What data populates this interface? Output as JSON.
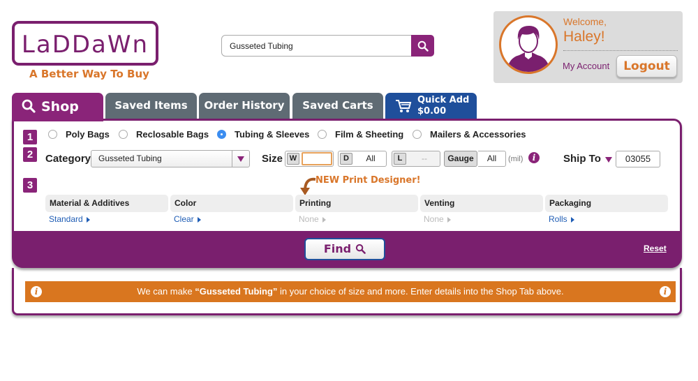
{
  "brand": {
    "logo_text": "LaDDaWn",
    "tagline": "A Better Way To Buy"
  },
  "search": {
    "value": "Gusseted Tubing",
    "icon": "search-icon"
  },
  "account": {
    "welcome": "Welcome,",
    "name": "Haley!",
    "my_account": "My Account",
    "logout": "Logout"
  },
  "tabs": {
    "shop": "Shop",
    "saved_items": "Saved Items",
    "order_history": "Order History",
    "saved_carts": "Saved Carts",
    "quick_add": {
      "label": "Quick Add",
      "amount": "$0.00"
    }
  },
  "steps": [
    "1",
    "2",
    "3"
  ],
  "product_types": [
    {
      "label": "Poly Bags",
      "selected": false
    },
    {
      "label": "Reclosable Bags",
      "selected": false
    },
    {
      "label": "Tubing & Sleeves",
      "selected": true
    },
    {
      "label": "Film & Sheeting",
      "selected": false
    },
    {
      "label": "Mailers & Accessories",
      "selected": false
    }
  ],
  "filters": {
    "category_label": "Category",
    "category_value": "Gusseted Tubing",
    "size_label": "Size",
    "width_key": "W",
    "width_value": "",
    "depth_key": "D",
    "depth_value": "All",
    "length_key": "L",
    "length_value": "--",
    "gauge_key": "Gauge",
    "gauge_value": "All",
    "gauge_unit": "(mil)",
    "ship_to_label": "Ship To",
    "ship_to_value": "03055"
  },
  "promo": "NEW Print Designer!",
  "options": [
    {
      "header": "Material & Additives",
      "value": "Standard",
      "enabled": true
    },
    {
      "header": "Color",
      "value": "Clear",
      "enabled": true
    },
    {
      "header": "Printing",
      "value": "None",
      "enabled": false
    },
    {
      "header": "Venting",
      "value": "None",
      "enabled": false
    },
    {
      "header": "Packaging",
      "value": "Rolls",
      "enabled": true
    }
  ],
  "actions": {
    "find": "Find",
    "reset": "Reset"
  },
  "banner": {
    "prefix": "We can make ",
    "product": "“Gusseted Tubing”",
    "suffix": " in your choice of size and more. Enter details into the Shop Tab above."
  },
  "colors": {
    "brand_purple": "#7a1f6e",
    "accent_orange": "#d9762a",
    "tab_gray": "#5f6b74",
    "quick_add_blue": "#1f4f9b",
    "radio_blue": "#3b8df0"
  }
}
